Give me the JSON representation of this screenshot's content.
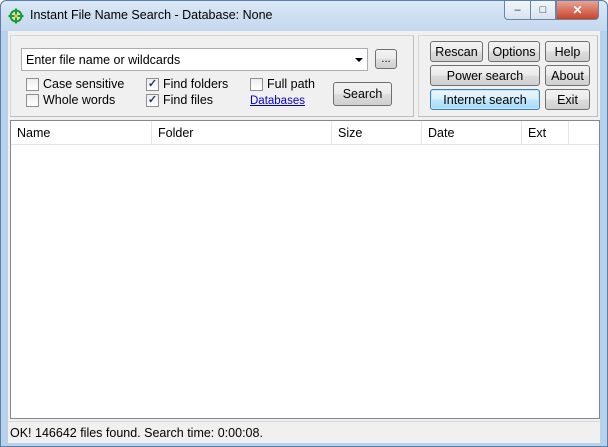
{
  "window": {
    "title": "Instant File Name Search - Database: None",
    "controls": {
      "minimize": "–",
      "maximize": "□",
      "close": "✕"
    }
  },
  "search": {
    "query_placeholder": "Enter file name or wildcards",
    "browse_label": "...",
    "options": [
      {
        "label": "Case sensitive",
        "checked": false
      },
      {
        "label": "Find folders",
        "checked": true
      },
      {
        "label": "Full path",
        "checked": false
      },
      {
        "label": "Whole words",
        "checked": false
      },
      {
        "label": "Find files",
        "checked": true
      }
    ],
    "databases_link": "Databases",
    "search_button": "Search"
  },
  "actions": {
    "rescan": "Rescan",
    "options": "Options",
    "help": "Help",
    "power_search": "Power search",
    "about": "About",
    "internet_search": "Internet search",
    "exit": "Exit"
  },
  "results": {
    "columns": [
      "Name",
      "Folder",
      "Size",
      "Date",
      "Ext"
    ],
    "rows": []
  },
  "status": {
    "text": "OK! 146642 files found. Search time: 0:00:08."
  }
}
